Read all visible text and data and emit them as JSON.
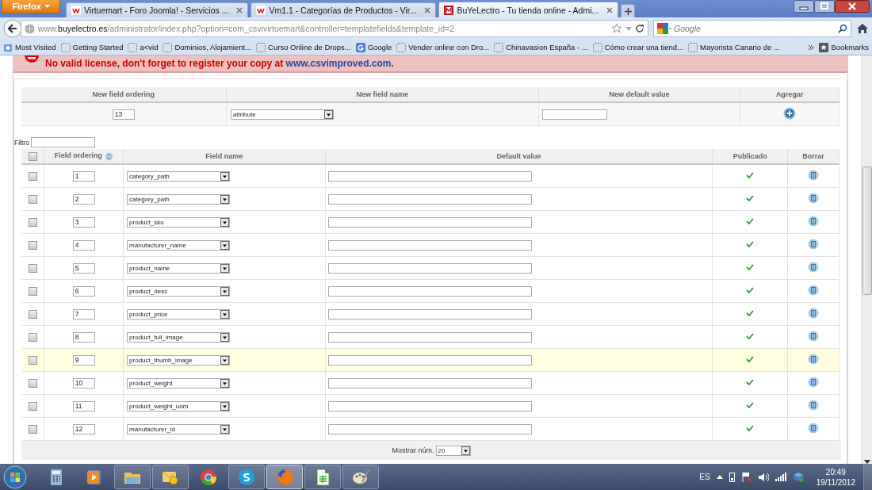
{
  "browser": {
    "menu_button": "Firefox",
    "tabs": [
      {
        "title": "Virtuemart - Foro Joomla! - Servicios ...",
        "kind": "virtuemart",
        "selected": false
      },
      {
        "title": "Vm1.1 - Categorías de Productos - Vir...",
        "kind": "virtuemart",
        "selected": false
      },
      {
        "title": "BuYeLectro - Tu tienda online - Admi...",
        "kind": "site",
        "selected": true
      }
    ],
    "address": "www.**buyelectro.es**/administrator/index.php?option=com_csvivirtuemart&controller=templatefields&template_id=2",
    "search_placeholder": "Google",
    "bookmarks": [
      {
        "label": "Most Visited",
        "kind": "smart"
      },
      {
        "label": "Getting Started",
        "kind": "page"
      },
      {
        "label": "a<vid",
        "kind": "page"
      },
      {
        "label": "Dominios, Alojamient...",
        "kind": "page"
      },
      {
        "label": "Curso Online de Drops...",
        "kind": "page"
      },
      {
        "label": "Google",
        "kind": "google"
      },
      {
        "label": "Vender online con Dro...",
        "kind": "page"
      },
      {
        "label": "Chinavasion España - ...",
        "kind": "page"
      },
      {
        "label": "Cómo crear una tiend...",
        "kind": "page"
      },
      {
        "label": "Mayorista Canario de ...",
        "kind": "page"
      }
    ],
    "bookmarks_menu": "Bookmarks"
  },
  "notice": {
    "message": "No valid license, don't forget to register your copy at ",
    "link": "www.csvimproved.com",
    "end": "."
  },
  "new_field": {
    "columns": [
      "New field ordering",
      "New field name",
      "New default value",
      "Agregar"
    ],
    "ordering": "13",
    "field_name": "attribute"
  },
  "filter": {
    "label": "Filtro"
  },
  "fields": {
    "all_checked": false,
    "columns": [
      "Field ordering",
      "Field name",
      "Default value",
      "Publicado",
      "Borrar"
    ],
    "rows": [
      {
        "checked": false,
        "ordering": "1",
        "field_name": "category_path",
        "published": true,
        "highlighted": false
      },
      {
        "checked": false,
        "ordering": "2",
        "field_name": "category_path",
        "published": true,
        "highlighted": false
      },
      {
        "checked": false,
        "ordering": "3",
        "field_name": "product_sku",
        "published": true,
        "highlighted": false
      },
      {
        "checked": false,
        "ordering": "4",
        "field_name": "manufacturer_name",
        "published": true,
        "highlighted": false
      },
      {
        "checked": false,
        "ordering": "5",
        "field_name": "product_name",
        "published": true,
        "highlighted": false
      },
      {
        "checked": false,
        "ordering": "6",
        "field_name": "product_desc",
        "published": true,
        "highlighted": false
      },
      {
        "checked": false,
        "ordering": "7",
        "field_name": "product_price",
        "published": true,
        "highlighted": false
      },
      {
        "checked": false,
        "ordering": "8",
        "field_name": "product_full_image",
        "published": true,
        "highlighted": false
      },
      {
        "checked": false,
        "ordering": "9",
        "field_name": "product_thumb_image",
        "published": true,
        "highlighted": true
      },
      {
        "checked": false,
        "ordering": "10",
        "field_name": "product_weight",
        "published": true,
        "highlighted": false
      },
      {
        "checked": false,
        "ordering": "11",
        "field_name": "product_weight_uom",
        "published": true,
        "highlighted": false
      },
      {
        "checked": false,
        "ordering": "12",
        "field_name": "manufacturer_id",
        "published": true,
        "highlighted": false
      }
    ]
  },
  "pagination": {
    "label": "Mostrar núm.",
    "per_page": "20"
  },
  "taskbar": {
    "apps": [
      {
        "kind": "calculator",
        "running": false,
        "selected": false
      },
      {
        "kind": "media",
        "running": false,
        "selected": false
      },
      {
        "kind": "folder",
        "running": true,
        "selected": false
      },
      {
        "kind": "mail",
        "running": true,
        "selected": false
      },
      {
        "kind": "chrome",
        "running": false,
        "selected": false
      },
      {
        "kind": "chat",
        "running": true,
        "selected": false
      },
      {
        "kind": "firefox",
        "running": true,
        "selected": true
      },
      {
        "kind": "sheet",
        "running": true,
        "selected": false
      },
      {
        "kind": "paint",
        "running": true,
        "selected": false
      }
    ],
    "language": "ES",
    "time": "20:49",
    "date": "19/11/2012"
  }
}
